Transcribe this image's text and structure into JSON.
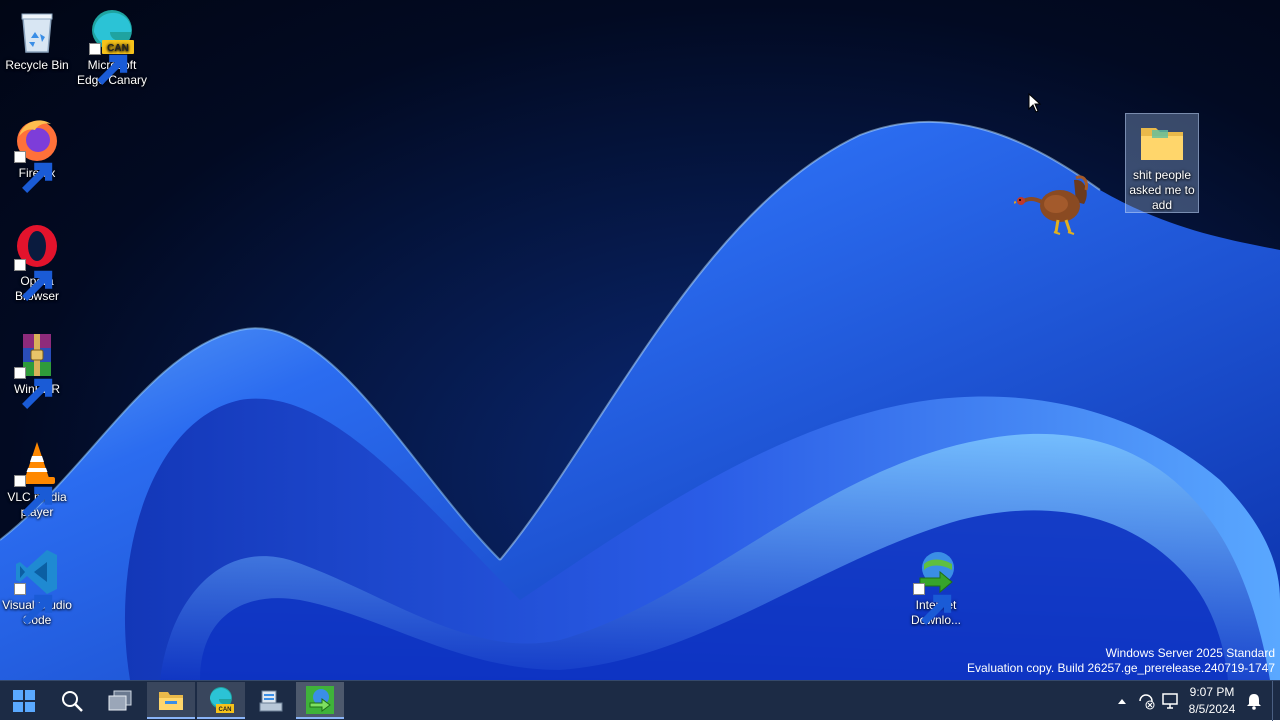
{
  "desktop_icons": [
    {
      "name": "recycle-bin",
      "label": "Recycle Bin",
      "icon": "recycle-bin-icon",
      "shortcut": false
    },
    {
      "name": "microsoft-edge-canary",
      "label": "Microsoft Edge Canary",
      "icon": "edge-canary-icon",
      "badge": "CAN",
      "shortcut": true
    },
    {
      "name": "firefox",
      "label": "Firefox",
      "icon": "firefox-icon",
      "shortcut": true
    },
    {
      "name": "opera-browser",
      "label": "Opera Browser",
      "icon": "opera-icon",
      "shortcut": true
    },
    {
      "name": "winrar",
      "label": "WinRAR",
      "icon": "winrar-icon",
      "shortcut": true
    },
    {
      "name": "vlc-media-player",
      "label": "VLC media player",
      "icon": "vlc-icon",
      "shortcut": true
    },
    {
      "name": "visual-studio-code",
      "label": "Visual Studio Code",
      "icon": "vscode-icon",
      "shortcut": true
    },
    {
      "name": "internet-download-manager",
      "label": "Internet Downlo...",
      "icon": "idm-icon",
      "shortcut": true
    },
    {
      "name": "folder",
      "label": "shit people asked me to add",
      "icon": "folder-icon",
      "shortcut": false,
      "selected": true
    }
  ],
  "watermark": {
    "line1": "Windows Server 2025 Standard",
    "line2": "Evaluation copy. Build 26257.ge_prerelease.240719-1747"
  },
  "taskbar": {
    "buttons": [
      {
        "name": "start-button",
        "icon": "windows-start-icon"
      },
      {
        "name": "search-button",
        "icon": "search-icon"
      },
      {
        "name": "task-view-button",
        "icon": "task-view-icon"
      },
      {
        "name": "file-explorer-button",
        "icon": "file-explorer-icon",
        "state": "running"
      },
      {
        "name": "edge-canary-taskbar-button",
        "icon": "edge-canary-icon",
        "badge": "CAN",
        "state": "running"
      },
      {
        "name": "server-manager-button",
        "icon": "server-manager-icon"
      },
      {
        "name": "idm-taskbar-button",
        "icon": "idm-icon",
        "state": "active"
      }
    ],
    "tray": {
      "overflow_icon": "chevron-up-icon",
      "icons": [
        "network-icon",
        "display-icon"
      ],
      "time": "9:07 PM",
      "date": "8/5/2024",
      "notification_icon": "bell-icon"
    }
  },
  "colors": {
    "taskbar_bg": "#1c2b45",
    "accent": "#8ab4f8",
    "wallpaper_dark": "#020a22",
    "wallpaper_blue": "#1a4fd8"
  }
}
